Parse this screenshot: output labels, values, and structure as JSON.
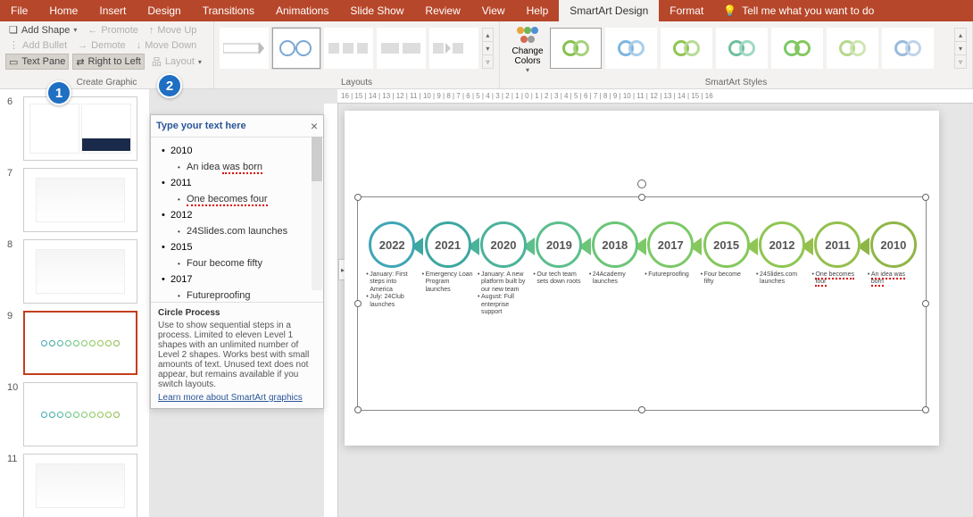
{
  "tabs": [
    "File",
    "Home",
    "Insert",
    "Design",
    "Transitions",
    "Animations",
    "Slide Show",
    "Review",
    "View",
    "Help",
    "SmartArt Design",
    "Format"
  ],
  "active_tab": "SmartArt Design",
  "tellme": "Tell me what you want to do",
  "create_graphic": {
    "label": "Create Graphic",
    "add_shape": "Add Shape",
    "add_bullet": "Add Bullet",
    "text_pane": "Text Pane",
    "promote": "Promote",
    "demote": "Demote",
    "right_to_left": "Right to Left",
    "move_up": "Move Up",
    "move_down": "Move Down",
    "layout": "Layout"
  },
  "layouts_label": "Layouts",
  "change_colors": "Change Colors",
  "styles_label": "SmartArt Styles",
  "ruler_h": "16 | 15 | 14 | 13 | 12 | 11 | 10 | 9 | 8 | 7 | 6 | 5 | 4 | 3 | 2 | 1 | 0 | 1 | 2 | 3 | 4 | 5 | 6 | 7 | 8 | 9 | 10 | 11 | 12 | 13 | 14 | 15 | 16",
  "slides": [
    "6",
    "7",
    "8",
    "9",
    "10",
    "11"
  ],
  "active_slide": "9",
  "textpane": {
    "header": "Type your text here",
    "items": [
      {
        "level": 1,
        "text": "2010"
      },
      {
        "level": 2,
        "text": "An idea ",
        "err": "was born"
      },
      {
        "level": 1,
        "text": "2011"
      },
      {
        "level": 2,
        "text": "",
        "err": "One becomes four"
      },
      {
        "level": 1,
        "text": "2012"
      },
      {
        "level": 2,
        "text": "24Slides.com launches"
      },
      {
        "level": 1,
        "text": "2015"
      },
      {
        "level": 2,
        "text": "Four become fifty"
      },
      {
        "level": 1,
        "text": "2017"
      },
      {
        "level": 2,
        "text": "Futureproofing"
      }
    ],
    "footer_title": "Circle Process",
    "footer_desc": "Use to show sequential steps in a process. Limited to eleven Level 1 shapes with an unlimited number of Level 2 shapes. Works best with small amounts of text. Unused text does not appear, but remains available if you switch layouts.",
    "footer_link": "Learn more about SmartArt graphics"
  },
  "timeline": [
    {
      "year": "2022",
      "color": "#3fa6b5",
      "bullets": [
        "January: First steps into America",
        "July: 24Club launches"
      ]
    },
    {
      "year": "2021",
      "color": "#3da7a0",
      "bullets": [
        "Emergency Loan Program launches"
      ]
    },
    {
      "year": "2020",
      "color": "#4bb39a",
      "bullets": [
        "January: A new platform built by our new team",
        "August: Full enterprise support"
      ]
    },
    {
      "year": "2019",
      "color": "#5cbf8c",
      "bullets": [
        "Our tech team sets down roots"
      ]
    },
    {
      "year": "2018",
      "color": "#6bc577",
      "bullets": [
        "24Academy launches"
      ]
    },
    {
      "year": "2017",
      "color": "#7cc968",
      "bullets": [
        "Futureproofing"
      ]
    },
    {
      "year": "2015",
      "color": "#86c85c",
      "bullets": [
        "Four become fifty"
      ]
    },
    {
      "year": "2012",
      "color": "#8fc653",
      "bullets": [
        "24Slides.com launches"
      ]
    },
    {
      "year": "2011",
      "color": "#95c04d",
      "bullets": [
        "One becomes four"
      ],
      "err": true
    },
    {
      "year": "2010",
      "color": "#8eb647",
      "bullets": [
        "An idea was born"
      ],
      "err": true
    }
  ],
  "callouts": {
    "c1": "1",
    "c2": "2"
  }
}
